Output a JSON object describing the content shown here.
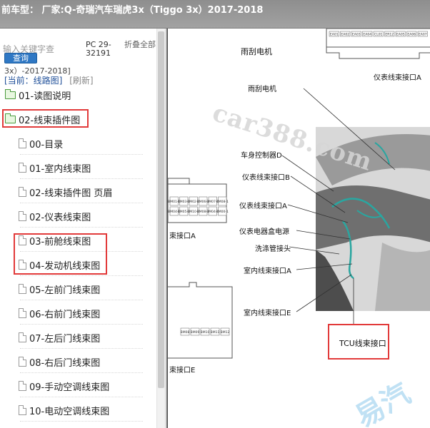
{
  "title_bar": {
    "text": "前车型： 厂家:Q-奇瑞汽车瑞虎3x（Tiggo 3x）2017-2018"
  },
  "sidebar": {
    "search": {
      "placeholder": "输入关键字查",
      "button_label": "查询"
    },
    "pc_code": "PC 29-32191",
    "collapse_all_label": "折叠全部",
    "breadcrumb_partial": "3x）-2017-2018]",
    "current_label": "[当前：线路图]",
    "refresh_label": "[刷新]",
    "tree": [
      {
        "label": "01-读图说明",
        "icon": "folder-icon"
      },
      {
        "label": "02-线束插件图",
        "icon": "folder-open-icon"
      },
      {
        "label": "00-目录",
        "icon": "document-icon"
      },
      {
        "label": "01-室内线束图",
        "icon": "document-icon"
      },
      {
        "label": "02-线束插件图 页眉",
        "icon": "document-icon"
      },
      {
        "label": "02-仪表线束图",
        "icon": "document-icon"
      },
      {
        "label": "03-前舱线束图",
        "icon": "document-icon"
      },
      {
        "label": "04-发动机线束图",
        "icon": "document-icon"
      },
      {
        "label": "05-左前门线束图",
        "icon": "document-icon"
      },
      {
        "label": "06-右前门线束图",
        "icon": "document-icon"
      },
      {
        "label": "07-左后门线束图",
        "icon": "document-icon"
      },
      {
        "label": "08-右后门线束图",
        "icon": "document-icon"
      },
      {
        "label": "09-手动空调线束图",
        "icon": "document-icon"
      },
      {
        "label": "10-电动空调线束图",
        "icon": "document-icon"
      }
    ]
  },
  "viewer": {
    "labels": {
      "wiper_motor_top": "雨刮电机",
      "wiper_motor": "雨刮电机",
      "instrument_connector_a_top": "仪表线束接口A",
      "body_controller_d": "车身控制器D",
      "instrument_connector_b": "仪表线束接口B",
      "instrument_connector_a": "仪表线束接口A",
      "instrument_fusebox_power": "仪表电器盒电源",
      "washer_hose": "洗涤管接头",
      "interior_connector_a": "室内线束接口A",
      "interior_connector_e": "室内线束接口E",
      "tcu_connector": "TCU线束接口",
      "left_connector_a": "束接口A",
      "left_connector_e": "束接口E"
    },
    "pin_codes_top": [
      "EA01",
      "EA02",
      "EA03",
      "EA04",
      "CL01",
      "ER12",
      "EA05",
      "EA06",
      "EA07"
    ],
    "pin_codes_left": [
      "BM01-1",
      "BM03-1",
      "BM02-1",
      "BM06-1",
      "BM07-1",
      "BM08-1",
      "BM04-1",
      "BM05-1",
      "BM10-1",
      "BM08-1",
      "BM04-1",
      "BM00-1"
    ],
    "pin_codes_left_e": [
      "BM08",
      "BM09",
      "BM10",
      "BM11",
      "BM12"
    ],
    "watermark": "car388.com",
    "watermark_bottom": "易汽"
  },
  "colors": {
    "accent": "#2f78c4",
    "highlight": "#e23a3a",
    "harness": "#2aa6a0"
  }
}
